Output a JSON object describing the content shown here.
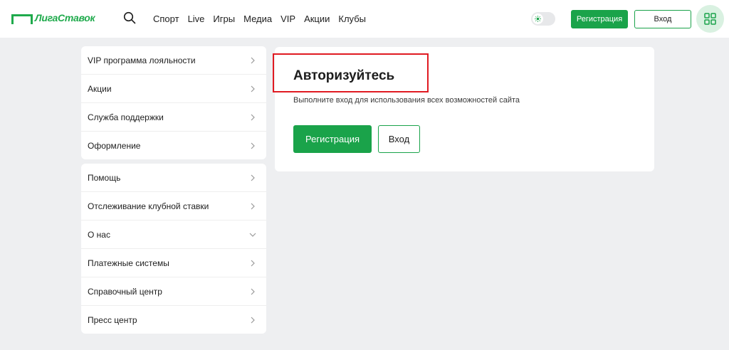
{
  "header": {
    "logo_text": "ЛигаСтавок",
    "nav": [
      {
        "label": "Спорт"
      },
      {
        "label": "Live"
      },
      {
        "label": "Игры"
      },
      {
        "label": "Медиа"
      },
      {
        "label": "VIP"
      },
      {
        "label": "Акции"
      },
      {
        "label": "Клубы"
      }
    ],
    "register_label": "Регистрация",
    "login_label": "Вход",
    "accent_color": "#1aa34a"
  },
  "sidebar": {
    "group1": [
      {
        "label": "VIP программа лояльности",
        "icon": "chevron-right-icon"
      },
      {
        "label": "Акции",
        "icon": "chevron-right-icon"
      },
      {
        "label": "Служба поддержки",
        "icon": "chevron-right-icon"
      },
      {
        "label": "Оформление",
        "icon": "chevron-right-icon"
      }
    ],
    "group2": [
      {
        "label": "Помощь",
        "icon": "chevron-right-icon"
      },
      {
        "label": "Отслеживание клубной ставки",
        "icon": "chevron-right-icon"
      },
      {
        "label": "О нас",
        "icon": "chevron-down-icon"
      },
      {
        "label": "Платежные системы",
        "icon": "chevron-right-icon"
      },
      {
        "label": "Справочный центр",
        "icon": "chevron-right-icon"
      },
      {
        "label": "Пресс центр",
        "icon": "chevron-right-icon"
      }
    ]
  },
  "main": {
    "title": "Авторизуйтесь",
    "subtitle": "Выполните вход для использования всех возможностей сайта",
    "register_label": "Регистрация",
    "login_label": "Вход",
    "highlight_color": "#e01a22"
  }
}
